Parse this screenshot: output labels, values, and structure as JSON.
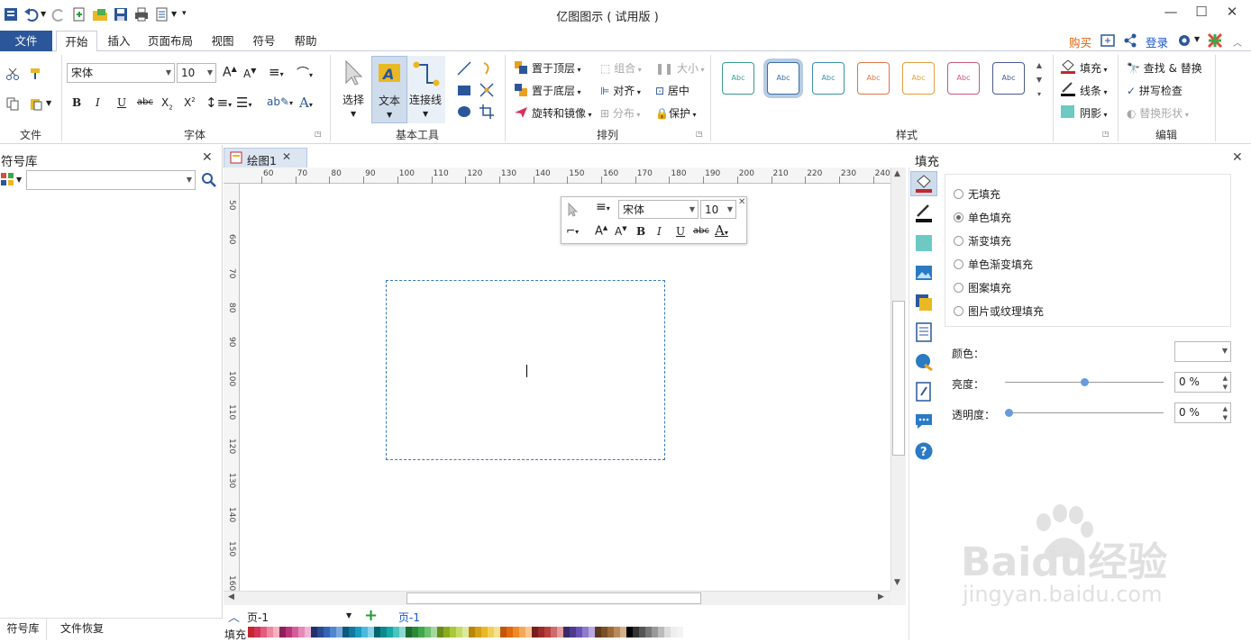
{
  "app": {
    "title": "亿图图示 ( 试用版 )"
  },
  "tabs": [
    "文件",
    "开始",
    "插入",
    "页面布局",
    "视图",
    "符号",
    "帮助"
  ],
  "top_right": {
    "buy": "购买",
    "login": "登录"
  },
  "ribbon": {
    "groups": {
      "file": "文件",
      "font": "字体",
      "basic_tools": "基本工具",
      "arrange": "排列",
      "styles": "样式",
      "edit": "编辑"
    },
    "font_name": "宋体",
    "font_size": "10",
    "tools": {
      "select": "选择",
      "text": "文本",
      "connector": "连接线"
    },
    "arrange": {
      "bring_front": "置于顶层",
      "send_back": "置于底层",
      "rotate": "旋转和镜像",
      "group": "组合",
      "align": "对齐",
      "distribute": "分布",
      "size": "大小",
      "center": "居中",
      "protect": "保护"
    },
    "style_label": "Abc",
    "style_colors": [
      "#3a9a8f",
      "#3a6ea5",
      "#3a8fa5",
      "#d9774a",
      "#e0a040",
      "#c75a78",
      "#4a5a8a"
    ],
    "fill": {
      "fill": "填充",
      "line": "线条",
      "shadow": "阴影"
    },
    "edit": {
      "find": "查找 & 替换",
      "spell": "拼写检查",
      "replace_shape": "替换形状"
    }
  },
  "symbol_lib": {
    "title": "符号库",
    "search_value": ""
  },
  "doc_tab": {
    "name": "绘图1"
  },
  "ruler_h": [
    "60",
    "70",
    "80",
    "90",
    "100",
    "110",
    "120",
    "130",
    "140",
    "150",
    "160",
    "170",
    "180",
    "190",
    "200",
    "210",
    "220",
    "230",
    "240"
  ],
  "ruler_v": [
    "50",
    "60",
    "70",
    "80",
    "90",
    "100",
    "110",
    "120",
    "130",
    "140",
    "150",
    "160"
  ],
  "mini_toolbar": {
    "font": "宋体",
    "size": "10"
  },
  "fill_panel": {
    "title": "填充",
    "options": [
      "无填充",
      "单色填充",
      "渐变填充",
      "单色渐变填充",
      "图案填充",
      "图片或纹理填充"
    ],
    "selected": 1,
    "color_label": "颜色：",
    "brightness_label": "亮度：",
    "brightness_value": "0 %",
    "brightness_level": 0.5,
    "transparency_label": "透明度：",
    "transparency_value": "0 %",
    "transparency_level": 0
  },
  "bottom": {
    "page_select": "页-1",
    "page_tab": "页-1",
    "fill_label": "填充",
    "tab_symbols": "符号库",
    "tab_recovery": "文件恢复"
  },
  "watermark": {
    "brand": "Baidu经验",
    "url": "jingyan.baidu.com"
  },
  "palette": [
    "#c1272d",
    "#d6335a",
    "#e35b7d",
    "#ee8aa0",
    "#f3b3c3",
    "#8e1f5b",
    "#b9347a",
    "#d45c9b",
    "#e58ab8",
    "#f0b6d4",
    "#20326b",
    "#2c4a8f",
    "#3464b4",
    "#4f86cc",
    "#7aa8dc",
    "#0b5a7a",
    "#12789e",
    "#1a9bc4",
    "#4cb9dc",
    "#8ad2ea",
    "#04646b",
    "#0a8a8f",
    "#14a8a6",
    "#4cc3bd",
    "#8ad9d2",
    "#1e6b2e",
    "#2b8a3a",
    "#3fa84a",
    "#6cc070",
    "#a2d89f",
    "#6b8a1a",
    "#8aab20",
    "#a9c83a",
    "#c6dc6a",
    "#dde99e",
    "#b8860b",
    "#d4a017",
    "#e8b923",
    "#f2cf5b",
    "#f7e08f",
    "#c2570c",
    "#e06a10",
    "#f08a24",
    "#f5a85a",
    "#f9c68f",
    "#7a1f1f",
    "#9a2b2b",
    "#b84040",
    "#d06a6a",
    "#e49c9c",
    "#3b2a6b",
    "#4f3a8f",
    "#6a52b4",
    "#8f7acc",
    "#b8a8e0",
    "#5a3a1a",
    "#7a5028",
    "#9a6a3a",
    "#b88a5a",
    "#d4b08a",
    "#000000",
    "#333333",
    "#555555",
    "#777777",
    "#999999",
    "#bbbbbb",
    "#dddddd",
    "#eeeeee",
    "#f4f4f4",
    "#ffffff"
  ]
}
